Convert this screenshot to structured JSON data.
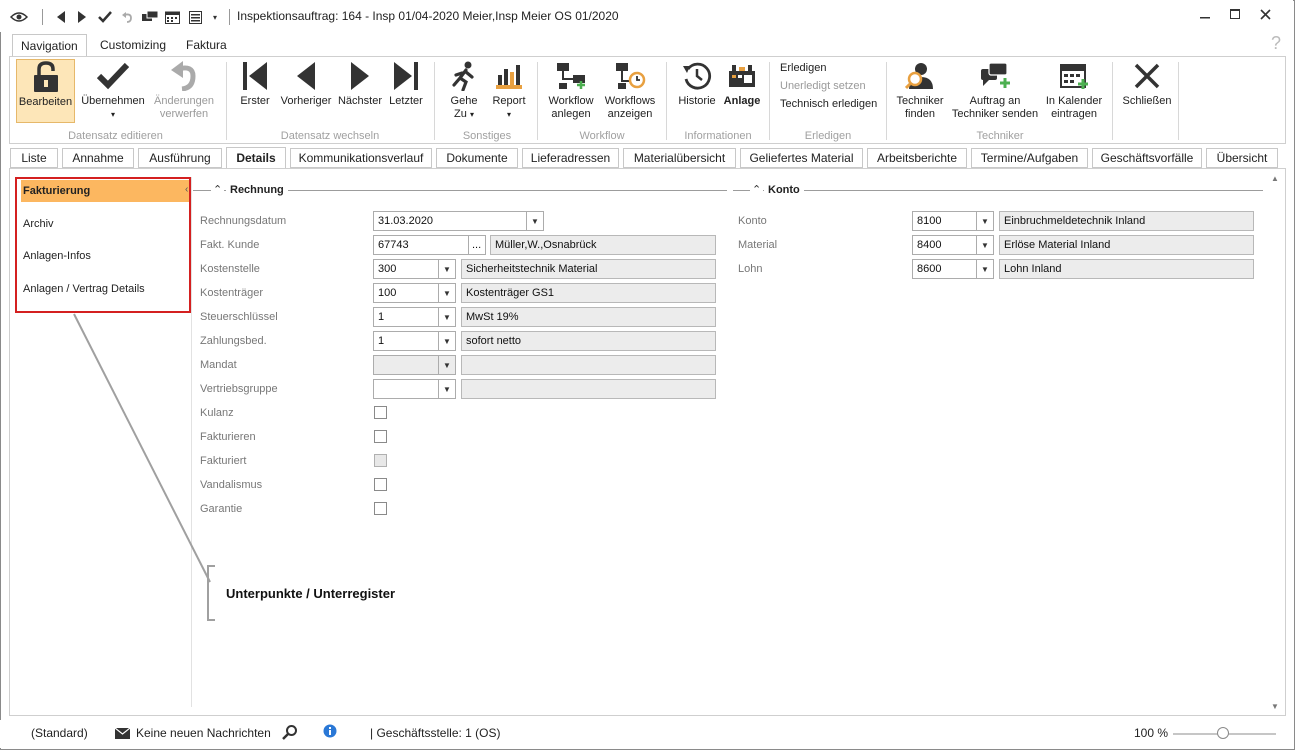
{
  "window": {
    "title": "Inspektionsauftrag: 164 - Insp 01/04-2020 Meier,Insp Meier OS 01/2020"
  },
  "ribbon_tabs": [
    "Navigation",
    "Customizing",
    "Faktura"
  ],
  "ribbon": {
    "bearbeiten": "Bearbeiten",
    "uebernehmen": "Übernehmen",
    "aenderungen_1": "Änderungen",
    "aenderungen_2": "verwerfen",
    "group_datensatz_editieren": "Datensatz editieren",
    "erster": "Erster",
    "vorheriger": "Vorheriger",
    "naechster": "Nächster",
    "letzter": "Letzter",
    "group_datensatz_wechseln": "Datensatz wechseln",
    "gehe_1": "Gehe",
    "gehe_2": "Zu",
    "report": "Report",
    "group_sonstiges": "Sonstiges",
    "wf_anlegen_1": "Workflow",
    "wf_anlegen_2": "anlegen",
    "wf_anzeigen_1": "Workflows",
    "wf_anzeigen_2": "anzeigen",
    "group_workflow": "Workflow",
    "historie": "Historie",
    "anlage": "Anlage",
    "group_informationen": "Informationen",
    "erledigen": "Erledigen",
    "unerledigt": "Unerledigt setzen",
    "technisch": "Technisch erledigen",
    "group_erledigen": "Erledigen",
    "tech_finden_1": "Techniker",
    "tech_finden_2": "finden",
    "auftrag_1": "Auftrag an",
    "auftrag_2": "Techniker senden",
    "kalender_1": "In Kalender",
    "kalender_2": "eintragen",
    "group_techniker": "Techniker",
    "schliessen": "Schließen",
    "accent_selected": "#fde6b8"
  },
  "doc_tabs": [
    "Liste",
    "Annahme",
    "Ausführung",
    "Details",
    "Kommunikationsverlauf",
    "Dokumente",
    "Lieferadressen",
    "Materialübersicht",
    "Geliefertes Material",
    "Arbeitsberichte",
    "Termine/Aufgaben",
    "Geschäftsvorfälle",
    "Übersicht"
  ],
  "left_nav": [
    "Fakturierung",
    "Archiv",
    "Anlagen-Infos",
    "Anlagen / Vertrag Details"
  ],
  "rechnung": {
    "header": "Rechnung",
    "labels": {
      "rechnungsdatum": "Rechnungsdatum",
      "fakt_kunde": "Fakt. Kunde",
      "kostenstelle": "Kostenstelle",
      "kostentraeger": "Kostenträger",
      "steuerschluessel": "Steuerschlüssel",
      "zahlungsbed": "Zahlungsbed.",
      "mandat": "Mandat",
      "vertriebsgruppe": "Vertriebsgruppe",
      "kulanz": "Kulanz",
      "fakturieren": "Fakturieren",
      "fakturiert": "Fakturiert",
      "vandalismus": "Vandalismus",
      "garantie": "Garantie"
    },
    "values": {
      "rechnungsdatum": "31.03.2020",
      "fakt_kunde": "67743",
      "fakt_kunde_name": "Müller,W.,Osnabrück",
      "ellipsis": "...",
      "kostenstelle": "300",
      "kostenstelle_name": "Sicherheitstechnik Material",
      "kostentraeger": "100",
      "kostentraeger_name": "Kostenträger GS1",
      "steuerschluessel": "1",
      "steuerschluessel_name": "MwSt 19%",
      "zahlungsbed": "1",
      "zahlungsbed_name": "sofort netto"
    }
  },
  "konto": {
    "header": "Konto",
    "labels": {
      "konto": "Konto",
      "material": "Material",
      "lohn": "Lohn"
    },
    "values": {
      "konto": "8100",
      "konto_name": "Einbruchmeldetechnik Inland",
      "material": "8400",
      "material_name": "Erlöse Material Inland",
      "lohn": "8600",
      "lohn_name": "Lohn Inland"
    }
  },
  "annotation": "Unterpunkte / Unterregister",
  "statusbar": {
    "standard": "(Standard)",
    "messages": "Keine neuen Nachrichten",
    "geschaeftsstelle": "| Geschäftsstelle:  1 (OS)",
    "zoom": "100 %"
  }
}
